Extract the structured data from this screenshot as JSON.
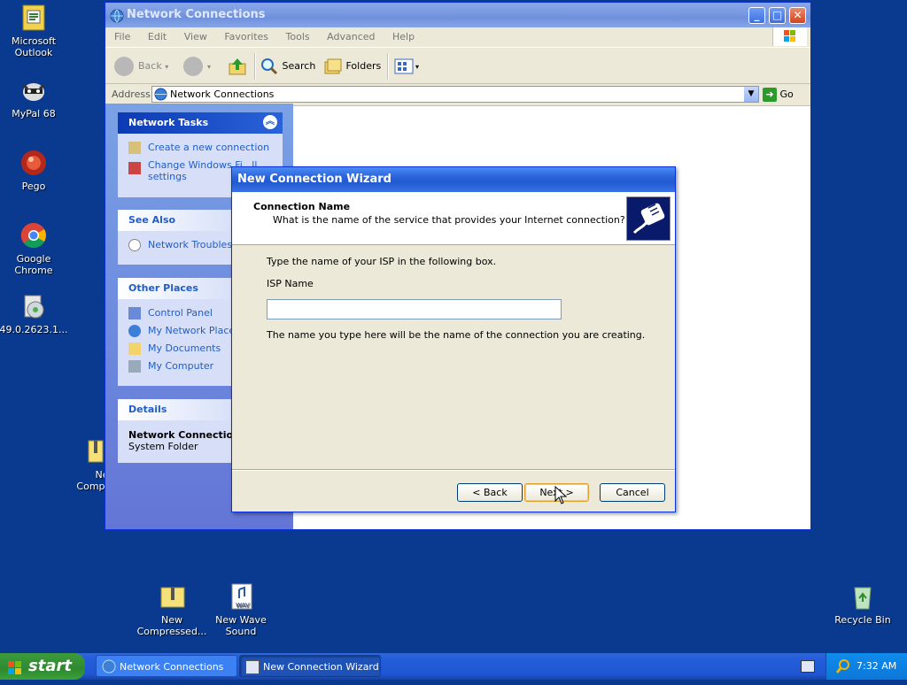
{
  "desktop": {
    "icons": [
      {
        "label": "Microsoft Outlook"
      },
      {
        "label": "MyPal 68"
      },
      {
        "label": "Pego"
      },
      {
        "label": "Google Chrome"
      },
      {
        "label": "49.0.2623.1..."
      },
      {
        "label_line1": "Ne",
        "label_line2": "Compre"
      },
      {
        "label_line1": "New",
        "label_line2": "Compressed..."
      },
      {
        "label_line1": "New Wave",
        "label_line2": "Sound"
      },
      {
        "label": "Recycle Bin"
      }
    ],
    "wav_badge": "WAV"
  },
  "explorer": {
    "title": "Network Connections",
    "menu": [
      "File",
      "Edit",
      "View",
      "Favorites",
      "Tools",
      "Advanced",
      "Help"
    ],
    "toolbar": {
      "back": "Back",
      "search": "Search",
      "folders": "Folders"
    },
    "address_label": "Address",
    "address_value": "Network Connections",
    "go_label": "Go",
    "panels": {
      "network_tasks": {
        "title": "Network Tasks",
        "items": [
          "Create a new connection",
          "Change Windows Fi...ll",
          "settings"
        ]
      },
      "see_also": {
        "title": "See Also",
        "items": [
          "Network Troublesho"
        ]
      },
      "other_places": {
        "title": "Other Places",
        "items": [
          "Control Panel",
          "My Network Places",
          "My Documents",
          "My Computer"
        ]
      },
      "details": {
        "title": "Details",
        "name": "Network Connection",
        "type": "System Folder"
      }
    }
  },
  "wizard": {
    "title": "New Connection Wizard",
    "heading": "Connection Name",
    "subheading": "What is the name of the service that provides your Internet connection?",
    "instruction": "Type the name of your ISP in the following box.",
    "isp_label": "ISP Name",
    "isp_value": "",
    "note": "The name you type here will be the name of the connection you are creating.",
    "back_label": "< Back",
    "next_label": "Next >",
    "cancel_label": "Cancel"
  },
  "taskbar": {
    "start_label": "start",
    "tasks": [
      "Network Connections",
      "New Connection Wizard"
    ],
    "clock": "7:32 AM"
  }
}
